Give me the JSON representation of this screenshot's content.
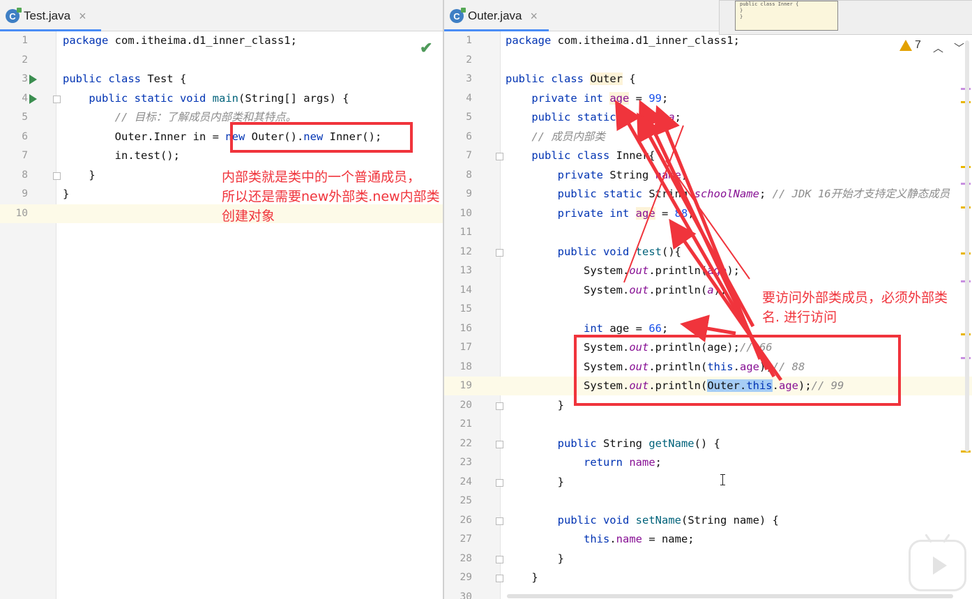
{
  "left_editor": {
    "tab_label": "Test.java",
    "tab_icon": "C",
    "close_glyph": "×",
    "status_check": "✔",
    "lines": [
      {
        "n": "1",
        "segs": [
          {
            "t": "package",
            "c": "kw"
          },
          {
            "t": " com.itheima.d1_inner_class1;"
          }
        ]
      },
      {
        "n": "2",
        "segs": []
      },
      {
        "n": "3",
        "segs": [
          {
            "t": "public class",
            "c": "kw"
          },
          {
            "t": " Test {"
          }
        ]
      },
      {
        "n": "4",
        "segs": [
          {
            "t": "    "
          },
          {
            "t": "public static void",
            "c": "kw"
          },
          {
            "t": " "
          },
          {
            "t": "main",
            "c": "fn"
          },
          {
            "t": "(String[] args) {"
          }
        ]
      },
      {
        "n": "5",
        "segs": [
          {
            "t": "        "
          },
          {
            "t": "// 目标：了解成员内部类和其特点。",
            "c": "cm"
          }
        ]
      },
      {
        "n": "6",
        "segs": [
          {
            "t": "        Outer.Inner in = "
          },
          {
            "t": "new",
            "c": "kw"
          },
          {
            "t": " Outer()."
          },
          {
            "t": "new",
            "c": "kw"
          },
          {
            "t": " Inner();"
          }
        ]
      },
      {
        "n": "7",
        "segs": [
          {
            "t": "        in.test();"
          }
        ]
      },
      {
        "n": "8",
        "segs": [
          {
            "t": "    }"
          }
        ]
      },
      {
        "n": "9",
        "segs": [
          {
            "t": "}"
          }
        ]
      },
      {
        "n": "10",
        "segs": []
      }
    ],
    "annotation": [
      "内部类就是类中的一个普通成员，",
      "所以还是需要new外部类.new内部类",
      "创建对象"
    ]
  },
  "right_editor": {
    "tab_label": "Outer.java",
    "tab_icon": "C",
    "close_glyph": "×",
    "warning_count": "7",
    "nav_up": "︿",
    "nav_down": "﹀",
    "lines": [
      {
        "n": "1",
        "segs": [
          {
            "t": "package",
            "c": "kw"
          },
          {
            "t": " com.itheima.d1_inner_class1;"
          }
        ]
      },
      {
        "n": "2",
        "segs": []
      },
      {
        "n": "3",
        "segs": [
          {
            "t": "public class",
            "c": "kw"
          },
          {
            "t": " "
          },
          {
            "t": "Outer",
            "c": "hl"
          },
          {
            "t": " {"
          }
        ]
      },
      {
        "n": "4",
        "segs": [
          {
            "t": "    "
          },
          {
            "t": "private int",
            "c": "kw"
          },
          {
            "t": " "
          },
          {
            "t": "age",
            "c": "fld hl"
          },
          {
            "t": " = "
          },
          {
            "t": "99",
            "c": "num"
          },
          {
            "t": ";"
          }
        ]
      },
      {
        "n": "5",
        "segs": [
          {
            "t": "    "
          },
          {
            "t": "public static",
            "c": "kw"
          },
          {
            "t": " String "
          },
          {
            "t": "a",
            "c": "st"
          },
          {
            "t": ";"
          }
        ]
      },
      {
        "n": "6",
        "segs": [
          {
            "t": "    "
          },
          {
            "t": "// 成员内部类",
            "c": "cm"
          }
        ]
      },
      {
        "n": "7",
        "segs": [
          {
            "t": "    "
          },
          {
            "t": "public class",
            "c": "kw"
          },
          {
            "t": " Inner{"
          }
        ]
      },
      {
        "n": "8",
        "segs": [
          {
            "t": "        "
          },
          {
            "t": "private",
            "c": "kw"
          },
          {
            "t": " String "
          },
          {
            "t": "name",
            "c": "fld"
          },
          {
            "t": ";"
          }
        ]
      },
      {
        "n": "9",
        "segs": [
          {
            "t": "        "
          },
          {
            "t": "public static",
            "c": "kw"
          },
          {
            "t": " String "
          },
          {
            "t": "schoolName",
            "c": "st"
          },
          {
            "t": "; "
          },
          {
            "t": "// JDK 16开始才支持定义静态成员",
            "c": "cm"
          }
        ]
      },
      {
        "n": "10",
        "segs": [
          {
            "t": "        "
          },
          {
            "t": "private int",
            "c": "kw"
          },
          {
            "t": " "
          },
          {
            "t": "age",
            "c": "fld hl"
          },
          {
            "t": " = "
          },
          {
            "t": "88",
            "c": "num"
          },
          {
            "t": ";"
          }
        ]
      },
      {
        "n": "11",
        "segs": []
      },
      {
        "n": "12",
        "segs": [
          {
            "t": "        "
          },
          {
            "t": "public void",
            "c": "kw"
          },
          {
            "t": " "
          },
          {
            "t": "test",
            "c": "fn"
          },
          {
            "t": "(){"
          }
        ]
      },
      {
        "n": "13",
        "segs": [
          {
            "t": "            System."
          },
          {
            "t": "out",
            "c": "st"
          },
          {
            "t": ".println("
          },
          {
            "t": "age",
            "c": "fld"
          },
          {
            "t": ");"
          }
        ]
      },
      {
        "n": "14",
        "segs": [
          {
            "t": "            System."
          },
          {
            "t": "out",
            "c": "st"
          },
          {
            "t": ".println("
          },
          {
            "t": "a",
            "c": "st"
          },
          {
            "t": ");"
          }
        ]
      },
      {
        "n": "15",
        "segs": []
      },
      {
        "n": "16",
        "segs": [
          {
            "t": "            "
          },
          {
            "t": "int",
            "c": "kw"
          },
          {
            "t": " age = "
          },
          {
            "t": "66",
            "c": "num"
          },
          {
            "t": ";"
          }
        ]
      },
      {
        "n": "17",
        "segs": [
          {
            "t": "            System."
          },
          {
            "t": "out",
            "c": "st"
          },
          {
            "t": ".println(age);"
          },
          {
            "t": "// 66",
            "c": "cm"
          }
        ]
      },
      {
        "n": "18",
        "segs": [
          {
            "t": "            System."
          },
          {
            "t": "out",
            "c": "st"
          },
          {
            "t": ".println("
          },
          {
            "t": "this",
            "c": "kw"
          },
          {
            "t": "."
          },
          {
            "t": "age",
            "c": "fld"
          },
          {
            "t": ");"
          },
          {
            "t": "// 88",
            "c": "cm"
          }
        ]
      },
      {
        "n": "19",
        "segs": [
          {
            "t": "            System."
          },
          {
            "t": "out",
            "c": "st"
          },
          {
            "t": ".println("
          },
          {
            "t": "Outer.",
            "c": "sel"
          },
          {
            "t": "this",
            "c": "kw sel"
          },
          {
            "t": "."
          },
          {
            "t": "age",
            "c": "fld"
          },
          {
            "t": ");"
          },
          {
            "t": "// 99",
            "c": "cm"
          }
        ]
      },
      {
        "n": "20",
        "segs": [
          {
            "t": "        }"
          }
        ]
      },
      {
        "n": "21",
        "segs": []
      },
      {
        "n": "22",
        "segs": [
          {
            "t": "        "
          },
          {
            "t": "public",
            "c": "kw"
          },
          {
            "t": " String "
          },
          {
            "t": "getName",
            "c": "fn"
          },
          {
            "t": "() {"
          }
        ]
      },
      {
        "n": "23",
        "segs": [
          {
            "t": "            "
          },
          {
            "t": "return",
            "c": "kw"
          },
          {
            "t": " "
          },
          {
            "t": "name",
            "c": "fld"
          },
          {
            "t": ";"
          }
        ]
      },
      {
        "n": "24",
        "segs": [
          {
            "t": "        }"
          }
        ]
      },
      {
        "n": "25",
        "segs": []
      },
      {
        "n": "26",
        "segs": [
          {
            "t": "        "
          },
          {
            "t": "public void",
            "c": "kw"
          },
          {
            "t": " "
          },
          {
            "t": "setName",
            "c": "fn"
          },
          {
            "t": "(String name) {"
          }
        ]
      },
      {
        "n": "27",
        "segs": [
          {
            "t": "            "
          },
          {
            "t": "this",
            "c": "kw"
          },
          {
            "t": "."
          },
          {
            "t": "name",
            "c": "fld"
          },
          {
            "t": " = name;"
          }
        ]
      },
      {
        "n": "28",
        "segs": [
          {
            "t": "        }"
          }
        ]
      },
      {
        "n": "29",
        "segs": [
          {
            "t": "    }"
          }
        ]
      },
      {
        "n": "30",
        "segs": []
      }
    ],
    "annotation": [
      "要访问外部类成员，必须外部类",
      "名. 进行访问"
    ]
  },
  "thumbnail_lines": [
    "public class Inner {",
    "    }",
    "}"
  ],
  "colors": {
    "annotation_red": "#f0343c",
    "keyword": "#0033b3",
    "comment": "#8c8c8c",
    "number": "#1750eb",
    "field": "#871094"
  },
  "icons": [
    "run-gutter-icon",
    "fold-icon",
    "check-icon",
    "warning-icon",
    "video-player-icon"
  ]
}
